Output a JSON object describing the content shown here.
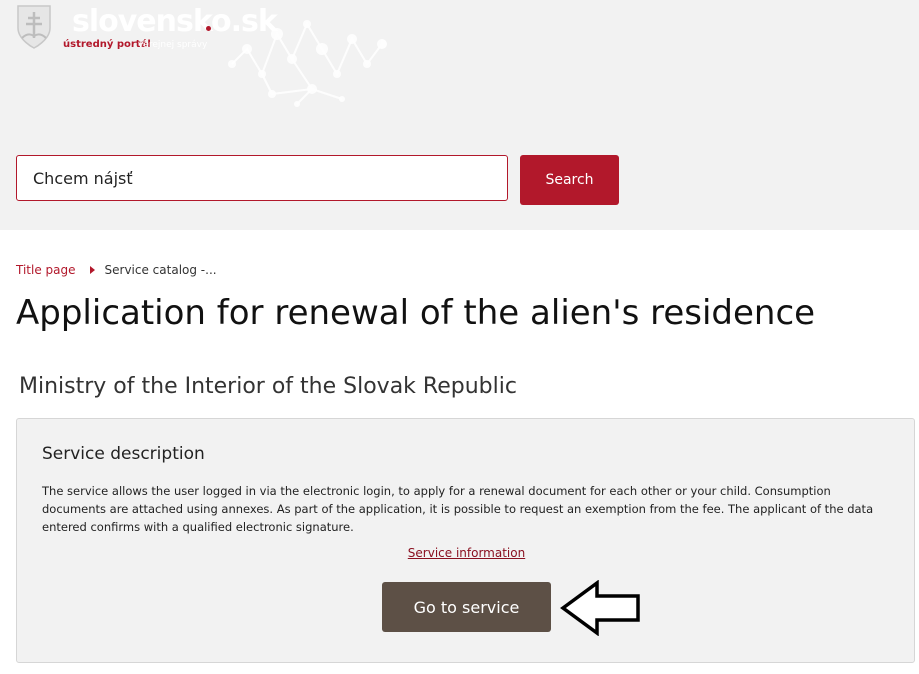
{
  "header": {
    "logo": {
      "wordmark": "slovensko.sk",
      "subtitle": "ústredný portál",
      "tagline": "verejnej správy"
    },
    "search": {
      "placeholder": "Chcem nájsť",
      "button_label": "Search"
    }
  },
  "breadcrumb": {
    "home": "Title page",
    "current": "Service catalog -..."
  },
  "page": {
    "title": "Application for renewal of the alien's residence",
    "provider": "Ministry of the Interior of the Slovak Republic"
  },
  "service": {
    "section_title": "Service description",
    "description": "The service allows the user logged in via the electronic login, to apply for a renewal document for each other or your child. Consumption documents are attached using annexes. As part of the application, it is possible to request an exemption from the fee. The applicant of the data entered confirms with a qualified electronic signature.",
    "info_link": "Service information",
    "go_button": "Go to service"
  },
  "colors": {
    "brand_red": "#b2182b",
    "go_button": "#5d5046",
    "header_bg": "#f2f2f2"
  },
  "icons": {
    "logo": "coat-of-arms-icon",
    "arrow": "arrow-left-outline-icon",
    "breadcrumb_separator": "caret-right-icon"
  }
}
